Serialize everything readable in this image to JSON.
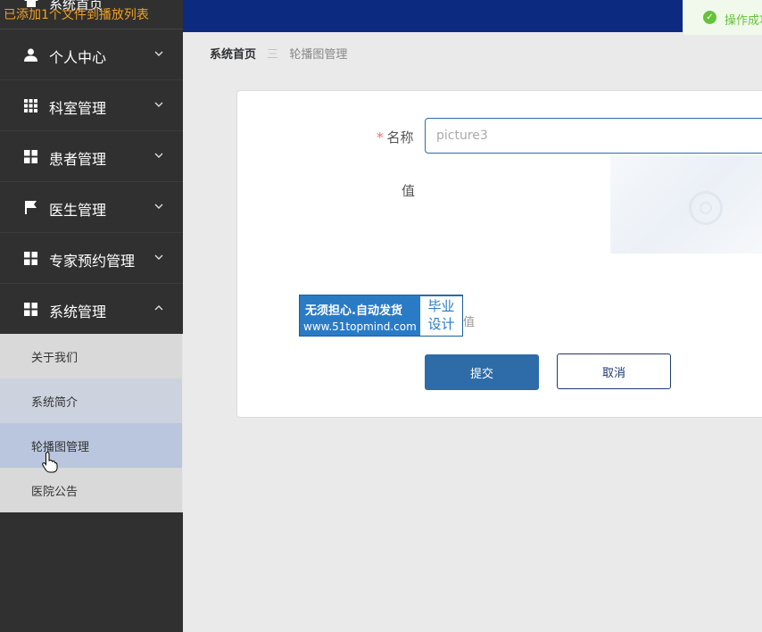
{
  "overlay_notice": "已添加1个文件到播放列表",
  "sidebar": {
    "home_label": "系统首页",
    "items": [
      {
        "label": "个人中心",
        "icon": "user-icon",
        "arrow": "down"
      },
      {
        "label": "科室管理",
        "icon": "grid-icon",
        "arrow": "down"
      },
      {
        "label": "患者管理",
        "icon": "apps-icon",
        "arrow": "down"
      },
      {
        "label": "医生管理",
        "icon": "flag-icon",
        "arrow": "down"
      },
      {
        "label": "专家预约管理",
        "icon": "apps-icon",
        "arrow": "down"
      },
      {
        "label": "系统管理",
        "icon": "apps-icon",
        "arrow": "up"
      }
    ],
    "submenu": [
      {
        "label": "关于我们"
      },
      {
        "label": "系统简介"
      },
      {
        "label": "轮播图管理"
      },
      {
        "label": "医院公告"
      }
    ]
  },
  "toast": {
    "text": "操作成功"
  },
  "breadcrumb": {
    "home": "系统首页",
    "separator": "三",
    "current": "轮播图管理"
  },
  "form": {
    "name_required": "*",
    "name_label": "名称",
    "name_value": "picture3",
    "value_label": "值",
    "hint_tail": "值",
    "submit_label": "提交",
    "cancel_label": "取消"
  },
  "watermark": {
    "line1": "无须担心.自动发货",
    "line2": "www.51topmind.com",
    "right_top": "毕业",
    "right_bottom": "设计"
  },
  "colors": {
    "sidebar_bg": "#303030",
    "topbar_bg": "#0c2a80",
    "primary": "#2d6ca8",
    "success": "#67c23a",
    "submenu_active": "#b9c6de"
  }
}
